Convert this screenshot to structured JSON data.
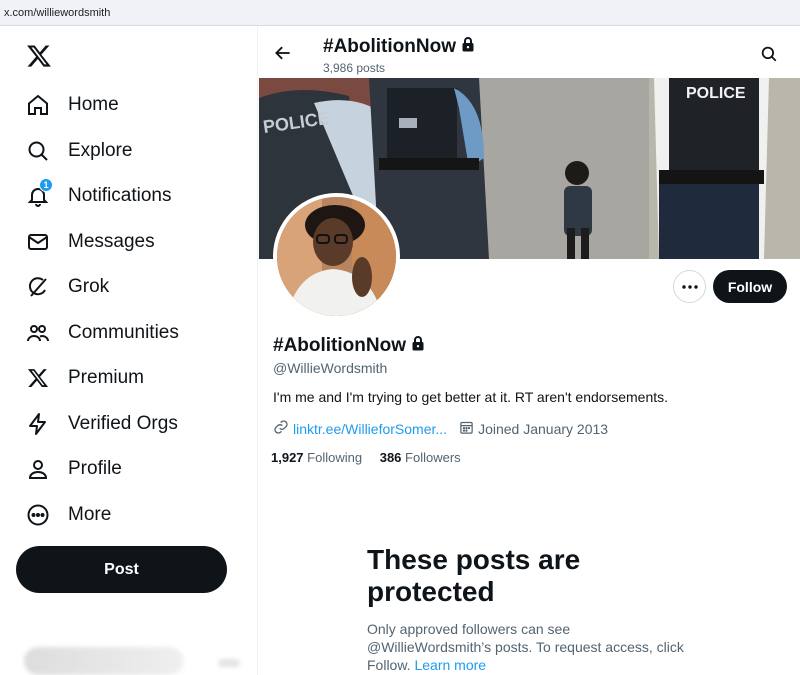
{
  "browser": {
    "url": "x.com/williewordsmith"
  },
  "sidebar": {
    "logo_icon": "x-logo-icon",
    "items": [
      {
        "label": "Home",
        "icon": "home-icon"
      },
      {
        "label": "Explore",
        "icon": "search-icon"
      },
      {
        "label": "Notifications",
        "icon": "bell-icon",
        "badge": "1"
      },
      {
        "label": "Messages",
        "icon": "envelope-icon"
      },
      {
        "label": "Grok",
        "icon": "grok-icon"
      },
      {
        "label": "Communities",
        "icon": "people-icon"
      },
      {
        "label": "Premium",
        "icon": "x-logo-icon"
      },
      {
        "label": "Verified Orgs",
        "icon": "lightning-icon"
      },
      {
        "label": "Profile",
        "icon": "person-icon"
      },
      {
        "label": "More",
        "icon": "more-circle-icon"
      }
    ],
    "post_label": "Post"
  },
  "header": {
    "title": "#AbolitionNow",
    "post_count": "3,986 posts"
  },
  "banner": {
    "sign_left": "POLICE",
    "sign_right": "POLICE"
  },
  "profile": {
    "name": "#AbolitionNow",
    "handle": "@WillieWordsmith",
    "bio": "I'm me and I'm trying to get better at it. RT aren't endorsements.",
    "link": "linktr.ee/WillieforSomer...",
    "joined": "Joined January 2013",
    "following_count": "1,927",
    "following_label": "Following",
    "followers_count": "386",
    "followers_label": "Followers",
    "follow_label": "Follow"
  },
  "protected": {
    "title": "These posts are protected",
    "text": "Only approved followers can see @WillieWordsmith’s posts. To request access, click Follow.",
    "link": "Learn more"
  },
  "colors": {
    "accent": "#1d9bf0",
    "text": "#0f1419",
    "muted": "#536471"
  }
}
